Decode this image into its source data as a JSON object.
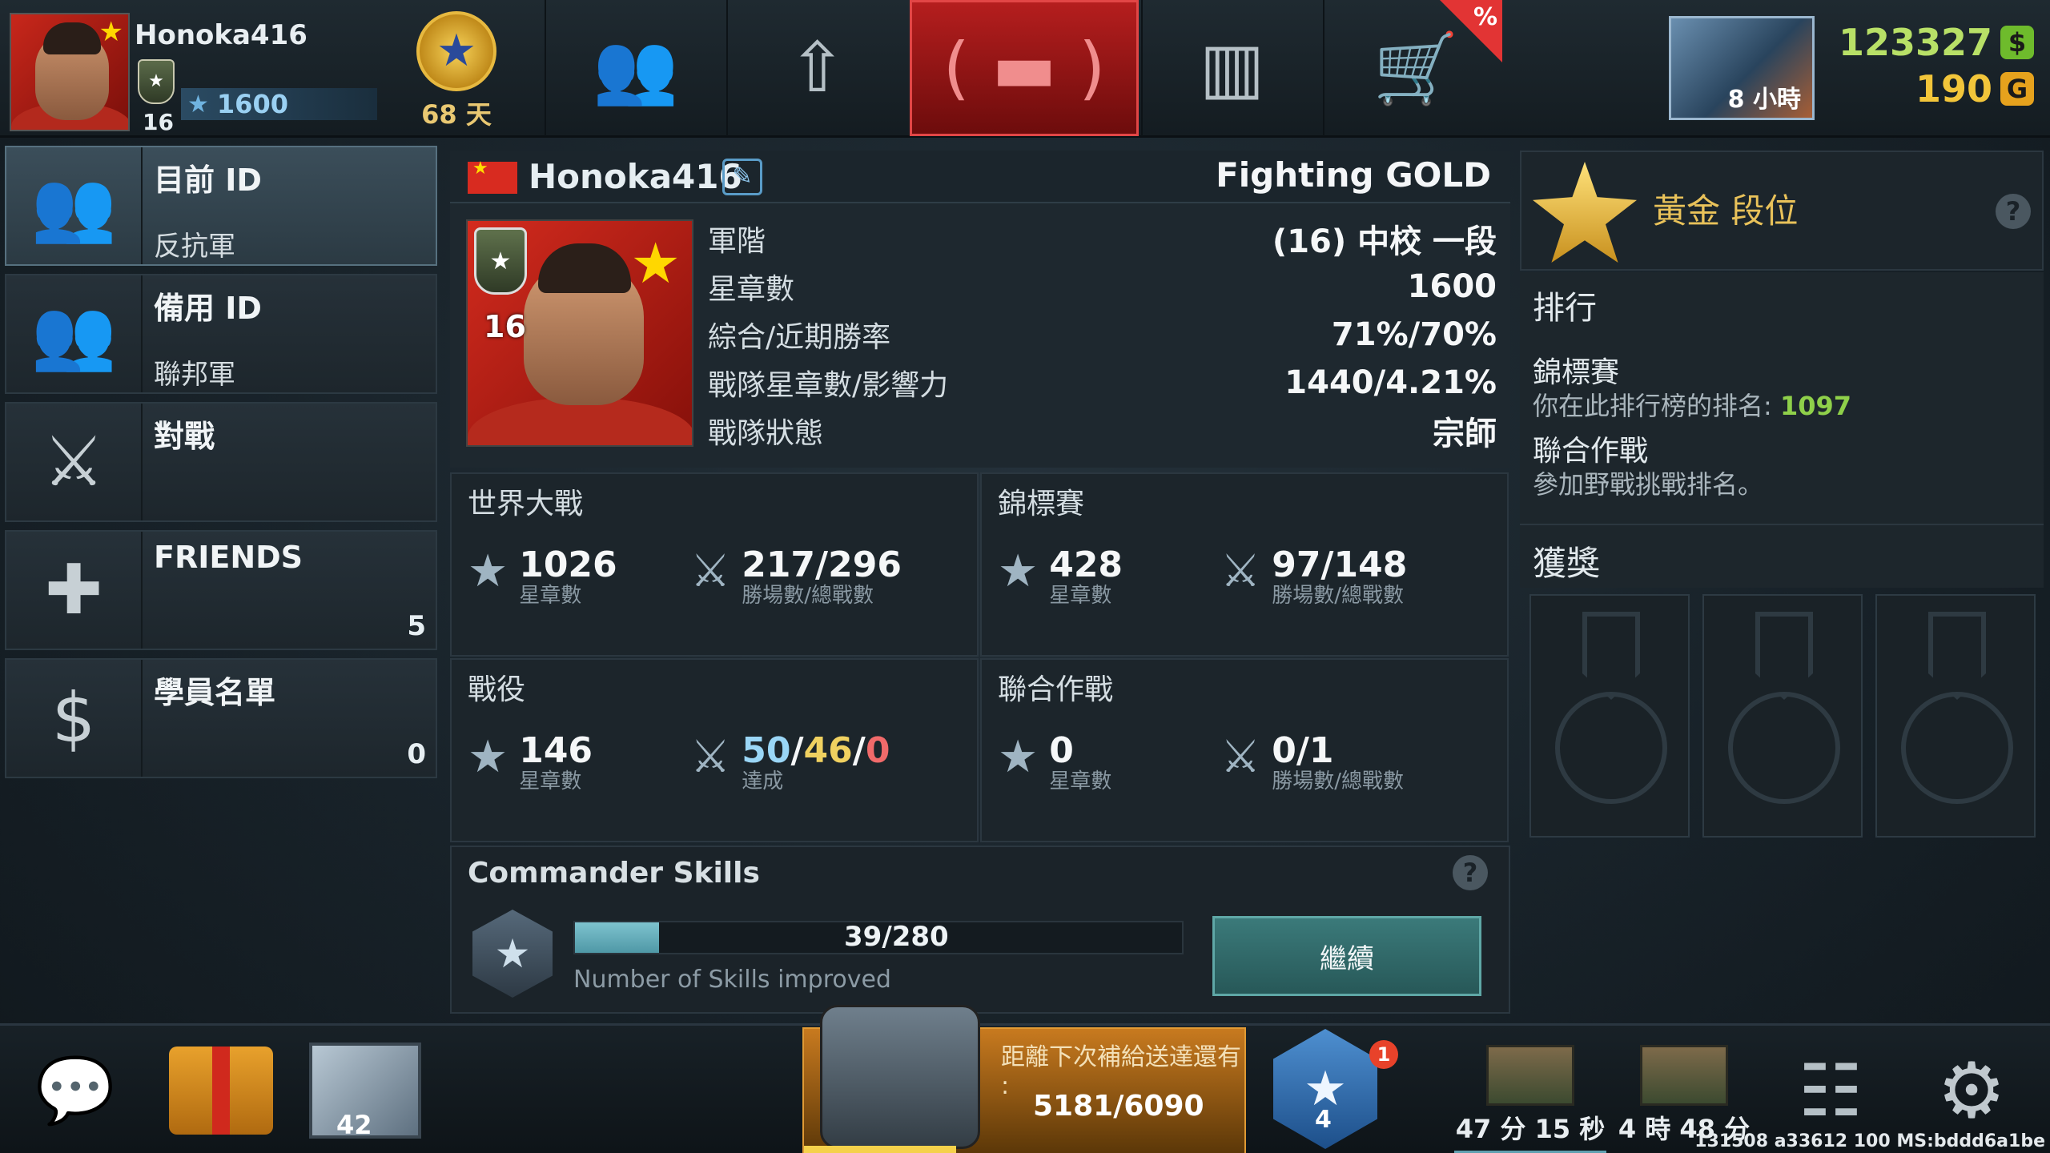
{
  "topbar": {
    "player_name": "Honoka416",
    "player_level": "16",
    "star_score": "1600",
    "days_label": "68 天",
    "sale_badge": "%",
    "event_timer": "8 小時",
    "cash": "123327",
    "gold": "190",
    "cash_icon": "$",
    "gold_icon": "G",
    "tabs": [
      {
        "name": "tab-friends",
        "icon": "people-icon"
      },
      {
        "name": "tab-upgrade",
        "icon": "upload-arrow-icon"
      },
      {
        "name": "tab-battle",
        "icon": "tank-icon"
      },
      {
        "name": "tab-leaderboard",
        "icon": "podium-icon"
      },
      {
        "name": "tab-shop",
        "icon": "cart-icon"
      }
    ]
  },
  "sidebar": {
    "items": [
      {
        "title": "目前 ID",
        "sub": "反抗軍",
        "count": ""
      },
      {
        "title": "備用 ID",
        "sub": "聯邦軍",
        "count": ""
      },
      {
        "title": "對戰",
        "sub": "",
        "count": ""
      },
      {
        "title": "FRIENDS",
        "sub": "",
        "count": "5"
      },
      {
        "title": "學員名單",
        "sub": "",
        "count": "0"
      }
    ]
  },
  "profile": {
    "name": "Honoka416",
    "league": "Fighting GOLD",
    "level": "16",
    "rows": [
      {
        "k": "軍階",
        "v": "(16) 中校 一段"
      },
      {
        "k": "星章數",
        "v": "1600"
      },
      {
        "k": "綜合/近期勝率",
        "v": "71%/70%"
      },
      {
        "k": "戰隊星章數/影響力",
        "v": "1440/4.21%"
      },
      {
        "k": "戰隊狀態",
        "v": "宗師"
      }
    ]
  },
  "stats": {
    "world_war": {
      "title": "世界大戰",
      "stars": "1026",
      "stars_label": "星章數",
      "record": "217/296",
      "record_label": "勝場數/總戰數"
    },
    "championship": {
      "title": "錦標賽",
      "stars": "428",
      "stars_label": "星章數",
      "record": "97/148",
      "record_label": "勝場數/總戰數"
    },
    "campaign": {
      "title": "戰役",
      "stars": "146",
      "stars_label": "星章數",
      "a": "50",
      "b": "46",
      "c": "0",
      "sep": "/",
      "record_label": "達成"
    },
    "joint_ops": {
      "title": "聯合作戰",
      "stars": "0",
      "stars_label": "星章數",
      "record": "0/1",
      "record_label": "勝場數/總戰數"
    }
  },
  "skills": {
    "title": "Commander Skills",
    "count": "39/280",
    "progress": 0.139,
    "label": "Number of Skills improved",
    "continue": "繼續",
    "help": "?"
  },
  "right": {
    "league_title": "黃金 段位",
    "help": "?",
    "rank_heading": "排行",
    "champ_title": "錦標賽",
    "champ_rank_prefix": "你在此排行榜的排名: ",
    "champ_rank": "1097",
    "joint_title": "聯合作戰",
    "joint_text": "參加野戰挑戰排名。",
    "awards_heading": "獲獎"
  },
  "bottombar": {
    "crate_count": "42",
    "supply_text": "距離下次補給送達還有",
    "supply_colon": ":",
    "supply_progress": "5181/6090",
    "rank_level": "4",
    "notification_count": "1",
    "timer1": "47 分 15 秒",
    "timer2": "4 時 48 分",
    "build_info": "131508 a33612 100 MS:bddd6a1be"
  }
}
